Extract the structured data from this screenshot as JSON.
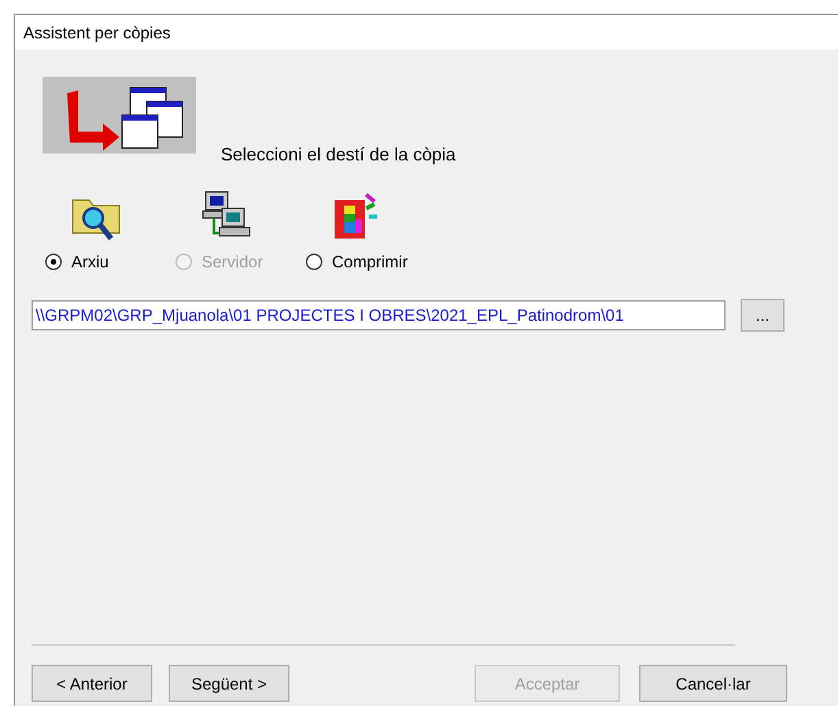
{
  "window": {
    "title": "Assistent per còpies"
  },
  "heading": "Seleccioni el destí de la còpia",
  "destinations": [
    {
      "kind": "folder",
      "label": "Arxiu",
      "selected": true,
      "disabled": false
    },
    {
      "kind": "server",
      "label": "Servidor",
      "selected": false,
      "disabled": true
    },
    {
      "kind": "compress",
      "label": "Comprimir",
      "selected": false,
      "disabled": false
    }
  ],
  "path_field": {
    "value": "\\\\GRPM02\\GRP_Mjuanola\\01 PROJECTES I OBRES\\2021_EPL_Patinodrom\\01"
  },
  "browse_button": "...",
  "buttons": [
    {
      "label": "< Anterior",
      "disabled": false
    },
    {
      "label": "Següent >",
      "disabled": false
    },
    {
      "label": "Acceptar",
      "disabled": true
    },
    {
      "label": "Cancel·lar",
      "disabled": false
    }
  ]
}
